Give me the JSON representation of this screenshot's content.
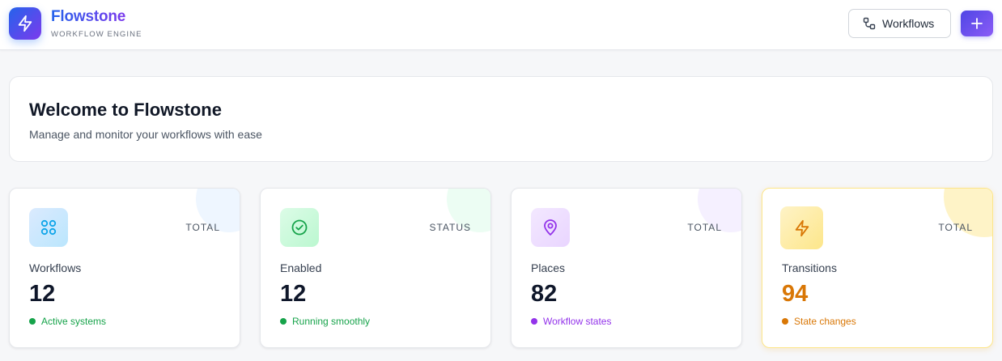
{
  "header": {
    "brand_name": "Flowstone",
    "brand_subtitle": "WORKFLOW ENGINE",
    "workflows_button": "Workflows",
    "add_icon": "plus-icon",
    "logo_icon": "lightning-icon"
  },
  "welcome": {
    "title": "Welcome to Flowstone",
    "subtitle": "Manage and monitor your workflows with ease"
  },
  "stats": [
    {
      "kind": "TOTAL",
      "label": "Workflows",
      "value": "12",
      "note": "Active systems",
      "icon": "grid-icon",
      "accent": "#0ea5e9",
      "note_color": "#16a34a"
    },
    {
      "kind": "STATUS",
      "label": "Enabled",
      "value": "12",
      "note": "Running smoothly",
      "icon": "check-circle-icon",
      "accent": "#16a34a",
      "note_color": "#16a34a"
    },
    {
      "kind": "TOTAL",
      "label": "Places",
      "value": "82",
      "note": "Workflow states",
      "icon": "map-pin-icon",
      "accent": "#9333ea",
      "note_color": "#9333ea"
    },
    {
      "kind": "TOTAL",
      "label": "Transitions",
      "value": "94",
      "note": "State changes",
      "icon": "lightning-icon",
      "accent": "#d97706",
      "note_color": "#d97706"
    }
  ]
}
